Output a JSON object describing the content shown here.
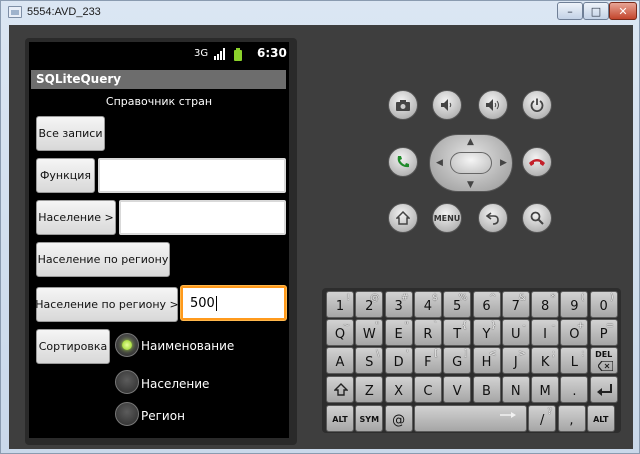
{
  "window": {
    "title": "5554:AVD_233",
    "minimize_glyph": "–",
    "maximize_glyph": "□",
    "close_glyph": "✕"
  },
  "statusbar": {
    "time": "6:30",
    "network_icon": "3G",
    "signal_icon": "signal-icon",
    "battery_icon": "battery-icon"
  },
  "app": {
    "title": "SQLiteQuery",
    "heading": "Справочник стран",
    "btn_all": "Все записи",
    "btn_function": "Функция",
    "function_value": "",
    "btn_population": "Население >",
    "population_value": "",
    "btn_population_region": "Население по региону",
    "btn_population_region_gt": "Население по региону >",
    "population_region_gt_value": "500",
    "btn_sort": "Сортировка",
    "sort_options": [
      {
        "label": "Наименование",
        "checked": true
      },
      {
        "label": "Население",
        "checked": false
      },
      {
        "label": "Регион",
        "checked": false
      }
    ]
  },
  "controls": {
    "row1": [
      "camera-icon",
      "volume-down-icon",
      "volume-up-icon",
      "power-icon"
    ],
    "row2": [
      "call-icon",
      "dpad",
      "end-call-icon"
    ],
    "row3": [
      "home-icon",
      "MENU",
      "back-icon",
      "search-icon"
    ]
  },
  "keyboard": {
    "row1": [
      [
        "1",
        "!"
      ],
      [
        "2",
        "@"
      ],
      [
        "3",
        "#"
      ],
      [
        "4",
        "$"
      ],
      [
        "5",
        "%"
      ],
      [
        "6",
        "^"
      ],
      [
        "7",
        "&"
      ],
      [
        "8",
        "*"
      ],
      [
        "9",
        "("
      ],
      [
        "0",
        ")"
      ]
    ],
    "row2": [
      [
        "Q",
        "~"
      ],
      [
        "W",
        "\""
      ],
      [
        "E",
        "\""
      ],
      [
        "R",
        "`"
      ],
      [
        "T",
        "{"
      ],
      [
        "Y",
        "}"
      ],
      [
        "U",
        "-"
      ],
      [
        "I",
        "-"
      ],
      [
        "O",
        "+"
      ],
      [
        "P",
        "="
      ]
    ],
    "row3": [
      [
        "A",
        ""
      ],
      [
        "S",
        "\\"
      ],
      [
        "D",
        "'"
      ],
      [
        "F",
        "["
      ],
      [
        "G",
        "]"
      ],
      [
        "H",
        "<"
      ],
      [
        "J",
        ">"
      ],
      [
        "K",
        ";"
      ],
      [
        "L",
        ":"
      ],
      [
        "DEL",
        ""
      ]
    ],
    "row4": [
      [
        "shift",
        ""
      ],
      [
        "Z",
        ""
      ],
      [
        "X",
        ""
      ],
      [
        "C",
        ""
      ],
      [
        "V",
        ""
      ],
      [
        "B",
        ""
      ],
      [
        "N",
        ""
      ],
      [
        "M",
        ""
      ],
      [
        ".",
        ""
      ],
      [
        "enter",
        ""
      ]
    ],
    "row5": [
      [
        "ALT",
        ""
      ],
      [
        "SYM",
        ""
      ],
      [
        "@",
        ""
      ],
      [
        "space",
        ""
      ],
      [
        "/",
        "?"
      ],
      [
        ",",
        ""
      ],
      [
        "ALT",
        ""
      ]
    ]
  }
}
